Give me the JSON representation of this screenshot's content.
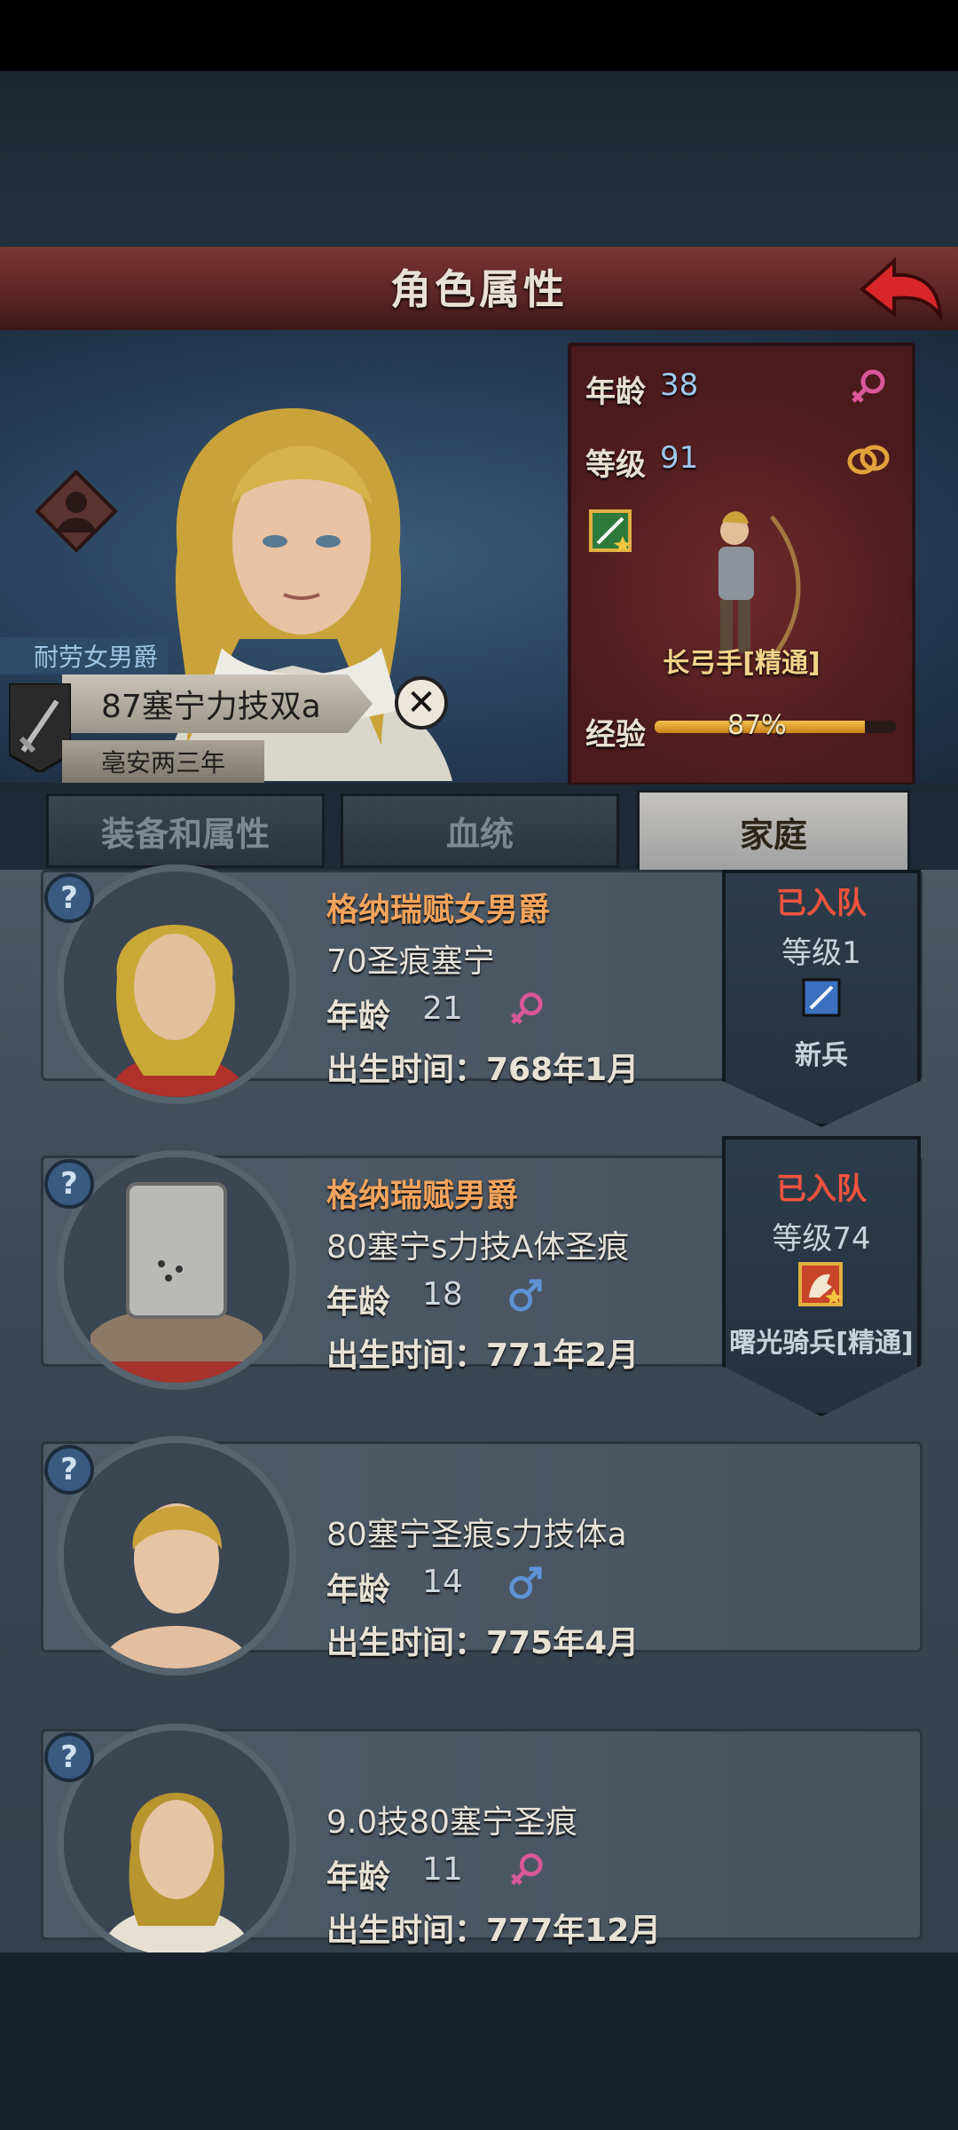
{
  "header": {
    "title": "角色属性"
  },
  "character": {
    "noble_title": "耐劳女男爵",
    "name": "87塞宁力技双a",
    "reign": "亳安两三年",
    "stats": {
      "age_label": "年龄",
      "age": "38",
      "level_label": "等级",
      "level": "91",
      "class_name": "长弓手[精通]",
      "exp_label": "经验",
      "exp": "87%",
      "exp_fraction": 0.87
    }
  },
  "tabs": [
    "装备和属性",
    "血统",
    "家庭"
  ],
  "active_tab": "家庭",
  "family": [
    {
      "title": "格纳瑞赋女男爵",
      "name": "70圣痕塞宁",
      "age_label": "年龄",
      "age": "21",
      "gender": "female",
      "birth": "出生时间：768年1月",
      "banner": {
        "status": "已入队",
        "level": "等级1",
        "class": "新兵"
      }
    },
    {
      "title": "格纳瑞赋男爵",
      "name": "80塞宁s力技A体圣痕",
      "age_label": "年龄",
      "age": "18",
      "gender": "male",
      "birth": "出生时间：771年2月",
      "banner": {
        "status": "已入队",
        "level": "等级74",
        "class": "曙光骑兵[精通]"
      }
    },
    {
      "title": "",
      "name": "80塞宁圣痕s力技体a",
      "age_label": "年龄",
      "age": "14",
      "gender": "male",
      "birth": "出生时间：775年4月"
    },
    {
      "title": "",
      "name": "9.0技80塞宁圣痕",
      "age_label": "年龄",
      "age": "11",
      "gender": "female",
      "birth": "出生时间：777年12月"
    }
  ],
  "colors": {
    "female": "#d9589a",
    "male": "#5d93d4",
    "title": "#f2a35c",
    "joined": "#f0533e"
  }
}
